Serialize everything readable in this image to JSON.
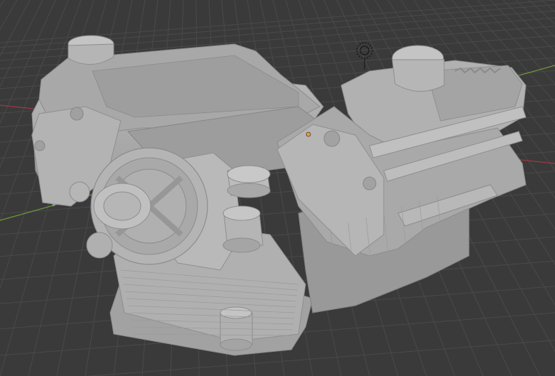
{
  "viewport": {
    "background_color": "#3a3a3a",
    "grid_color": "#4a4a4a",
    "x_axis_color": "#9a3b44",
    "y_axis_color": "#6f9a3a"
  },
  "scene": {
    "object": "v8-engine-mesh",
    "mesh_color": "#a9a9a9",
    "selection_origin_color": "#f29a2e"
  },
  "gizmo": {
    "icon": "camera-light-icon"
  }
}
